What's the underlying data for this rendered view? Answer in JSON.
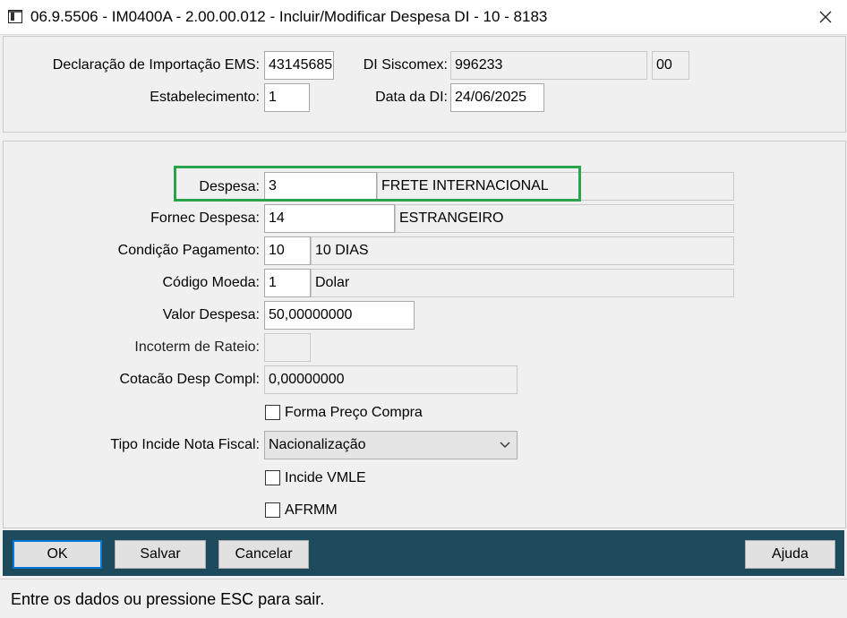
{
  "window": {
    "title": "06.9.5506 - IM0400A - 2.00.00.012 - Incluir/Modificar Despesa DI - 10 - 8183",
    "close_glyph": "✕"
  },
  "header": {
    "di_ems_label": "Declaração de Importação EMS:",
    "di_ems_value": "43145685",
    "di_siscomex_label": "DI Siscomex:",
    "di_siscomex_value": "996233",
    "di_siscomex_suffix": "00",
    "estabelecimento_label": "Estabelecimento:",
    "estabelecimento_value": "1",
    "data_di_label": "Data da DI:",
    "data_di_value": "24/06/2025"
  },
  "form": {
    "despesa_label": "Despesa:",
    "despesa_code": "3",
    "despesa_desc": "FRETE INTERNACIONAL",
    "fornec_label": "Fornec Despesa:",
    "fornec_code": "14",
    "fornec_desc": "ESTRANGEIRO",
    "condicao_label": "Condição Pagamento:",
    "condicao_code": "10",
    "condicao_desc": "10 DIAS",
    "moeda_label": "Código Moeda:",
    "moeda_code": "1",
    "moeda_desc": "Dolar",
    "valor_label": "Valor Despesa:",
    "valor_value": "50,00000000",
    "incoterm_label": "Incoterm de Rateio:",
    "incoterm_value": "",
    "cotacao_label": "Cotacão Desp Compl:",
    "cotacao_value": "0,00000000",
    "forma_preco_label": "Forma Preço Compra",
    "forma_preco_checked": false,
    "tipo_incide_label": "Tipo Incide Nota Fiscal:",
    "tipo_incide_value": "Nacionalização",
    "incide_vmle_label": "Incide VMLE",
    "incide_vmle_checked": false,
    "afrmm_label": "AFRMM",
    "afrmm_checked": false
  },
  "buttons": {
    "ok": "OK",
    "salvar": "Salvar",
    "cancelar": "Cancelar",
    "ajuda": "Ajuda"
  },
  "status": {
    "text": "Entre os dados ou pressione ESC para sair."
  },
  "colors": {
    "highlight": "#2aa44a",
    "button_bar": "#1e4a5e",
    "ok_focus": "#0078d7"
  }
}
